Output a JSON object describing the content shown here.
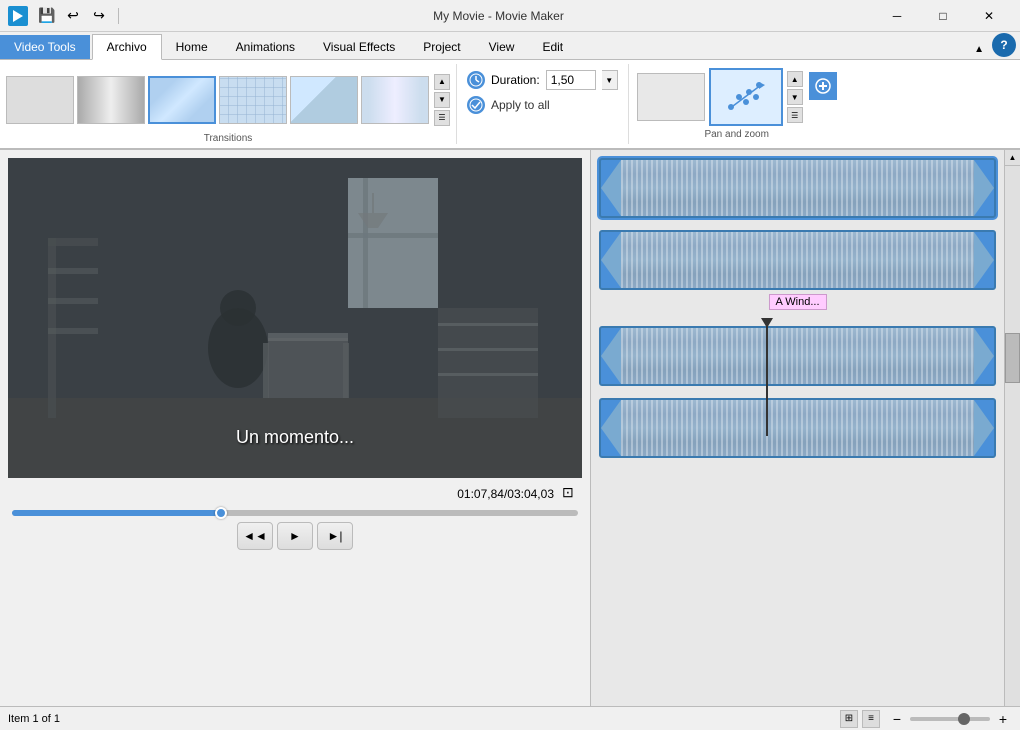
{
  "titleBar": {
    "title": "My Movie - Movie Maker",
    "videoToolsLabel": "Video Tools"
  },
  "tabs": [
    {
      "id": "archivo",
      "label": "Archivo",
      "active": true
    },
    {
      "id": "home",
      "label": "Home"
    },
    {
      "id": "animations",
      "label": "Animations"
    },
    {
      "id": "visual-effects",
      "label": "Visual Effects"
    },
    {
      "id": "project",
      "label": "Project"
    },
    {
      "id": "view",
      "label": "View"
    },
    {
      "id": "edit",
      "label": "Edit"
    }
  ],
  "ribbon": {
    "transitions": {
      "label": "Transitions",
      "items": [
        {
          "id": "empty",
          "type": "empty"
        },
        {
          "id": "fade",
          "type": "fade"
        },
        {
          "id": "selected",
          "type": "selected",
          "active": true
        },
        {
          "id": "grid",
          "type": "grid"
        },
        {
          "id": "arrow",
          "type": "arrow"
        },
        {
          "id": "blur",
          "type": "blur"
        }
      ]
    },
    "duration": {
      "label": "Duration:",
      "value": "1,50"
    },
    "applyToAll": {
      "label": "Apply to all"
    },
    "panAndZoom": {
      "label": "Pan and zoom"
    }
  },
  "preview": {
    "subtitle": "Un momento...",
    "timeDisplay": "01:07,84/03:04,03",
    "progress": 37
  },
  "playback": {
    "rewindLabel": "◄◄",
    "playLabel": "►",
    "forwardLabel": "►|"
  },
  "timeline": {
    "clips": [
      {
        "id": "clip1",
        "hasPlayhead": false,
        "selected": true
      },
      {
        "id": "clip2",
        "hasPlayhead": false,
        "label": "A Wind...",
        "hasLabel": true
      },
      {
        "id": "clip3",
        "hasPlayhead": true
      },
      {
        "id": "clip4",
        "hasPlayhead": false
      }
    ]
  },
  "statusBar": {
    "itemText": "Item 1 of 1"
  }
}
